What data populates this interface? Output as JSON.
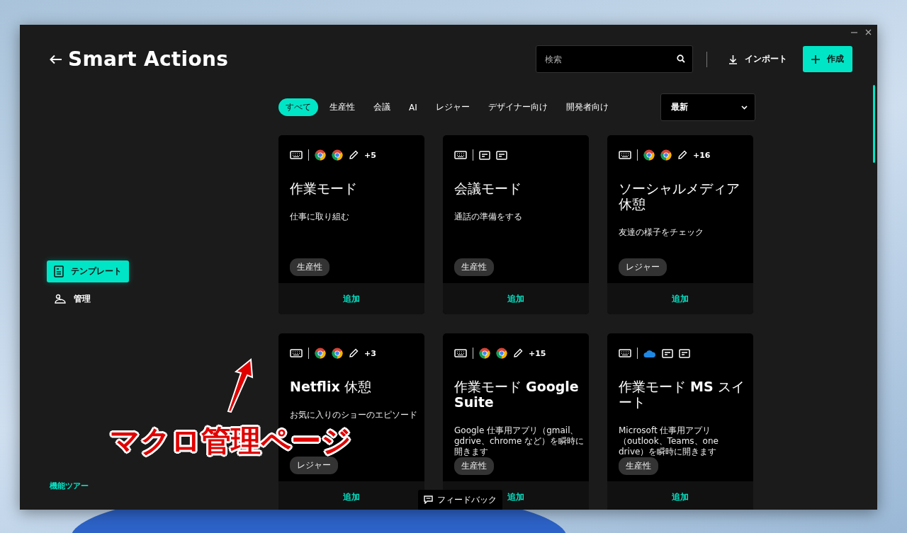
{
  "window": {
    "title": "Smart Actions"
  },
  "search": {
    "placeholder": "検索"
  },
  "import_button": "インポート",
  "create_button": "作成",
  "sidebar": {
    "items": [
      {
        "label": "テンプレート",
        "kind": "template",
        "selected": true
      },
      {
        "label": "管理",
        "kind": "manage",
        "selected": false
      }
    ],
    "tour_link": "機能ツアー"
  },
  "filters": [
    {
      "label": "すべて",
      "selected": true
    },
    {
      "label": "生産性",
      "selected": false
    },
    {
      "label": "会議",
      "selected": false
    },
    {
      "label": "AI",
      "selected": false
    },
    {
      "label": "レジャー",
      "selected": false
    },
    {
      "label": "デザイナー向け",
      "selected": false
    },
    {
      "label": "開発者向け",
      "selected": false
    }
  ],
  "sort": {
    "value": "最新"
  },
  "cards": [
    {
      "icons": [
        {
          "kind": "keyboard"
        },
        {
          "kind": "chrome"
        },
        {
          "kind": "chrome"
        },
        {
          "kind": "pencil"
        }
      ],
      "extra": "+5",
      "title": "作業モード",
      "description": "仕事に取り組む",
      "tag": "生産性",
      "action": "追加"
    },
    {
      "icons": [
        {
          "kind": "keyboard"
        },
        {
          "kind": "window"
        },
        {
          "kind": "window"
        }
      ],
      "title": "会議モード",
      "description": "通話の準備をする",
      "tag": "生産性",
      "action": "追加"
    },
    {
      "icons": [
        {
          "kind": "keyboard"
        },
        {
          "kind": "chrome"
        },
        {
          "kind": "chrome"
        },
        {
          "kind": "pencil"
        }
      ],
      "extra": "+16",
      "title": "ソーシャルメディア休憩",
      "description": "友達の様子をチェック",
      "tag": "レジャー",
      "action": "追加"
    },
    {
      "icons": [
        {
          "kind": "keyboard"
        },
        {
          "kind": "chrome"
        },
        {
          "kind": "chrome"
        },
        {
          "kind": "pencil"
        }
      ],
      "extra": "+3",
      "title": "**Netflix** 休憩",
      "description": "お気に入りのショーのエピソード",
      "tag": "レジャー",
      "action": "追加"
    },
    {
      "icons": [
        {
          "kind": "keyboard"
        },
        {
          "kind": "chrome"
        },
        {
          "kind": "chrome"
        },
        {
          "kind": "pencil"
        }
      ],
      "extra": "+15",
      "title": "作業モード **Google Suite**",
      "description": "Google 仕事用アプリ（gmail、gdrive、chrome など）を瞬時に開きます",
      "tag": "生産性",
      "action": "追加"
    },
    {
      "icons": [
        {
          "kind": "keyboard"
        },
        {
          "kind": "cloud"
        },
        {
          "kind": "window"
        },
        {
          "kind": "window"
        }
      ],
      "title": "作業モード **MS** スイート",
      "description": "Microsoft 仕事用アプリ（outlook、Teams、one drive）を瞬時に開きます",
      "tag": "生産性",
      "action": "追加"
    }
  ],
  "feedback_button": "フィードバック",
  "annotation": {
    "text": "マクロ管理ページ"
  }
}
